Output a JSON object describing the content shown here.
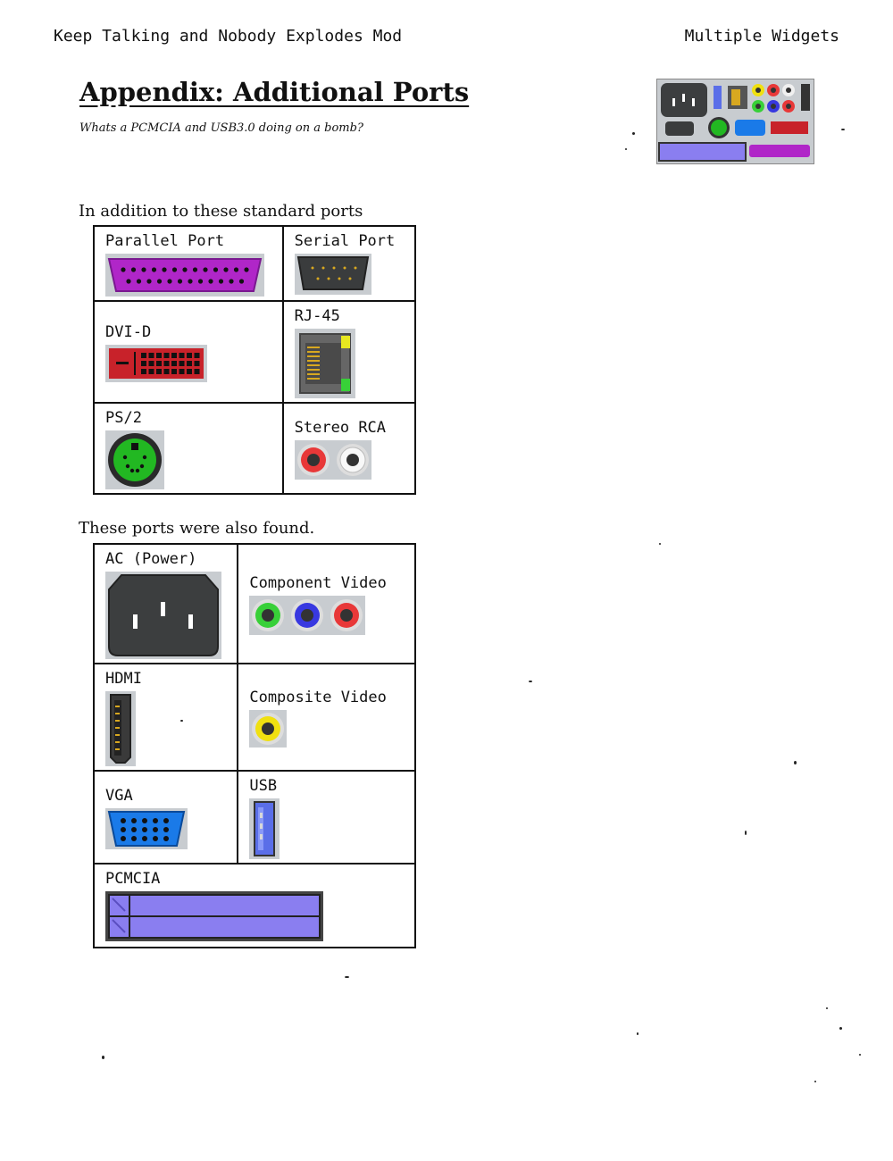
{
  "header": {
    "left": "Keep Talking and Nobody Explodes Mod",
    "right": "Multiple Widgets"
  },
  "title": "Appendix: Additional Ports",
  "subtitle": "Whats a PCMCIA and USB3.0 doing on a bomb?",
  "standard_intro": "In addition to these standard ports",
  "standard_ports": [
    {
      "label": "Parallel Port",
      "icon": "parallel-port-icon"
    },
    {
      "label": "Serial Port",
      "icon": "serial-port-icon"
    },
    {
      "label": "DVI-D",
      "icon": "dvi-d-port-icon"
    },
    {
      "label": "RJ-45",
      "icon": "rj45-port-icon"
    },
    {
      "label": "PS/2",
      "icon": "ps2-port-icon"
    },
    {
      "label": "Stereo RCA",
      "icon": "stereo-rca-port-icon"
    }
  ],
  "extra_intro": "These ports were also found.",
  "extra_ports": [
    {
      "label": "AC (Power)",
      "icon": "ac-power-port-icon"
    },
    {
      "label": "Component Video",
      "icon": "component-video-port-icon"
    },
    {
      "label": "HDMI",
      "icon": "hdmi-port-icon"
    },
    {
      "label": "Composite Video",
      "icon": "composite-video-port-icon"
    },
    {
      "label": "VGA",
      "icon": "vga-port-icon"
    },
    {
      "label": "USB",
      "icon": "usb-port-icon"
    },
    {
      "label": "PCMCIA",
      "icon": "pcmcia-port-icon"
    }
  ],
  "colors": {
    "parallel": "#b026c8",
    "serial": "#3a3c3d",
    "dvi": "#c8222a",
    "ps2": "#22b822",
    "vga": "#1a7ae8",
    "usb": "#5a6ee8",
    "pcmcia": "#8a7ef0",
    "ac": "#3c3e3f",
    "rca_red": "#e83838",
    "rca_white": "#f0f0f0",
    "rca_yellow": "#f0e010",
    "rca_green": "#38d038",
    "rca_blue": "#3838e0"
  }
}
